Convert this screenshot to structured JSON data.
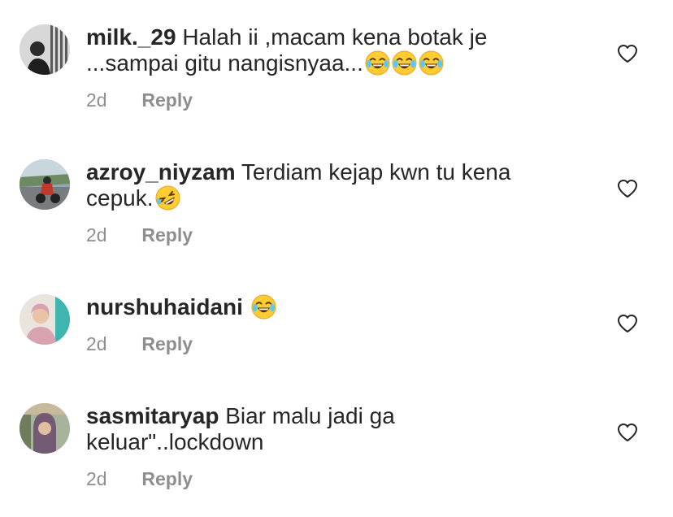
{
  "comments": [
    {
      "username": "milk._29",
      "text": "Halah ii ,macam kena botak je ...sampai gitu nangisnyaa...",
      "emoji": [
        "face-with-tears-of-joy",
        "face-with-tears-of-joy",
        "face-with-tears-of-joy"
      ],
      "time": "2d",
      "reply_label": "Reply"
    },
    {
      "username": "azroy_niyzam",
      "text": "Terdiam kejap kwn tu kena cepuk.",
      "emoji": [
        "rolling-on-floor-laughing"
      ],
      "time": "2d",
      "reply_label": "Reply"
    },
    {
      "username": "nurshuhaidani",
      "text": "",
      "emoji": [
        "face-with-tears-of-joy"
      ],
      "time": "2d",
      "reply_label": "Reply"
    },
    {
      "username": "sasmitaryap",
      "text": "Biar malu jadi ga keluar\"..lockdown",
      "emoji": [],
      "time": "2d",
      "reply_label": "Reply"
    }
  ],
  "colors": {
    "text": "#262626",
    "meta": "#8e8e8e",
    "heart_outline": "#262626"
  }
}
